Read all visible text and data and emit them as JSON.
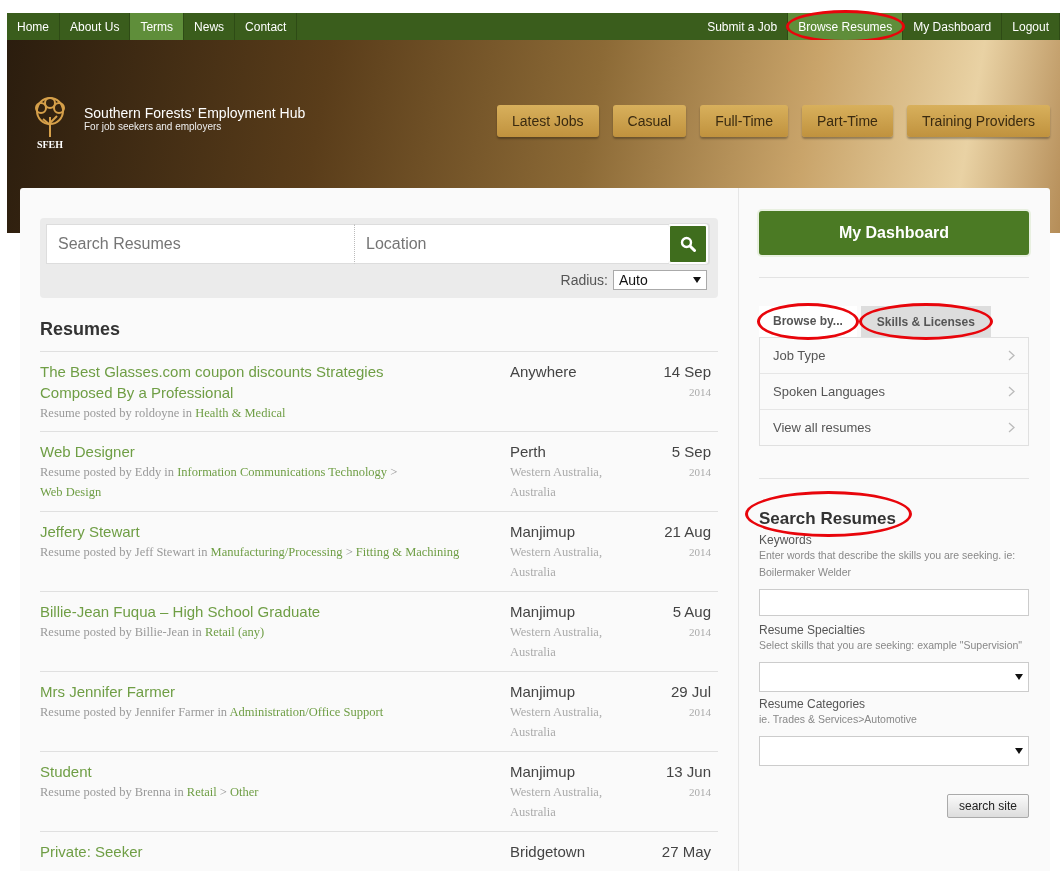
{
  "nav": {
    "left": [
      {
        "label": "Home",
        "selected": false
      },
      {
        "label": "About Us",
        "selected": false
      },
      {
        "label": "Terms",
        "selected": true
      },
      {
        "label": "News",
        "selected": false
      },
      {
        "label": "Contact",
        "selected": false
      }
    ],
    "right": [
      {
        "label": "Submit a Job",
        "selected": false,
        "circled": false
      },
      {
        "label": "Browse Resumes",
        "selected": true,
        "circled": true
      },
      {
        "label": "My Dashboard",
        "selected": false,
        "circled": false
      },
      {
        "label": "Logout",
        "selected": false,
        "circled": false
      }
    ]
  },
  "header": {
    "logo_text": "SFEH",
    "site_title": "Southern Forests’ Employment Hub",
    "tagline": "For job seekers and employers",
    "categories": [
      "Latest Jobs",
      "Casual",
      "Full-Time",
      "Part-Time",
      "Training Providers"
    ]
  },
  "search": {
    "keywords_placeholder": "Search Resumes",
    "location_placeholder": "Location",
    "radius_label": "Radius:",
    "radius_value": "Auto"
  },
  "resumes": {
    "heading": "Resumes",
    "rows": [
      {
        "title": "The Best Glasses.com coupon discounts Strategies Composed By a Professional",
        "byline": "Resume posted by roldoyne in",
        "path": [
          {
            "kind": "link",
            "text": "Health & Medical"
          }
        ],
        "city": "Anywhere",
        "day": "14 Sep",
        "year": "2014"
      },
      {
        "title": "Web Designer",
        "byline": "Resume posted by Eddy in",
        "path": [
          {
            "kind": "link",
            "text": "Information Communications Technology"
          },
          {
            "kind": "sep",
            "text": ">"
          },
          {
            "kind": "link",
            "text": "Web Design"
          }
        ],
        "city": "Perth",
        "region": "Western Australia, Australia",
        "day": "5 Sep",
        "year": "2014"
      },
      {
        "title": "Jeffery Stewart",
        "byline": "Resume posted by Jeff Stewart in",
        "path": [
          {
            "kind": "link",
            "text": "Manufacturing/Processing"
          },
          {
            "kind": "sep",
            "text": ">"
          },
          {
            "kind": "link",
            "text": "Fitting & Machining"
          }
        ],
        "city": "Manjimup",
        "region": "Western Australia, Australia",
        "day": "21 Aug",
        "year": "2014"
      },
      {
        "title": "Billie-Jean Fuqua – High School Graduate",
        "byline": "Resume posted by Billie-Jean in",
        "path": [
          {
            "kind": "link",
            "text": "Retail (any)"
          }
        ],
        "city": "Manjimup",
        "region": "Western Australia, Australia",
        "day": "5 Aug",
        "year": "2014"
      },
      {
        "title": "Mrs Jennifer Farmer",
        "byline": "Resume posted by Jennifer Farmer in",
        "path": [
          {
            "kind": "link",
            "text": "Administration/Office Support"
          }
        ],
        "city": "Manjimup",
        "region": "Western Australia, Australia",
        "day": "29 Jul",
        "year": "2014"
      },
      {
        "title": "Student",
        "byline": "Resume posted by Brenna in",
        "path": [
          {
            "kind": "link",
            "text": "Retail"
          },
          {
            "kind": "sep",
            "text": ">"
          },
          {
            "kind": "link",
            "text": "Other"
          }
        ],
        "city": "Manjimup",
        "region": "Western Australia, Australia",
        "day": "13 Jun",
        "year": "2014"
      },
      {
        "title": "Private: Seeker",
        "city": "Bridgetown",
        "day": "27 May"
      }
    ]
  },
  "sidebar": {
    "dashboard_button": "My Dashboard",
    "tabs": [
      {
        "label": "Browse by...",
        "selected": true,
        "circled": true
      },
      {
        "label": "Skills & Licenses",
        "selected": false,
        "circled": true
      }
    ],
    "browse_items": [
      "Job Type",
      "Spoken Languages",
      "View all resumes"
    ],
    "search_form": {
      "heading": "Search Resumes",
      "heading_circled": true,
      "fields": [
        {
          "kind": "text",
          "label": "Keywords",
          "hint": "Enter words that describe the skills you are seeking. ie: Boilermaker Welder"
        },
        {
          "kind": "select",
          "label": "Resume Specialties",
          "hint": "Select skills that you are seeking: example \"Supervision\""
        },
        {
          "kind": "select",
          "label": "Resume Categories",
          "hint": "ie. Trades & Services>Automotive"
        }
      ],
      "submit": "search site"
    }
  }
}
